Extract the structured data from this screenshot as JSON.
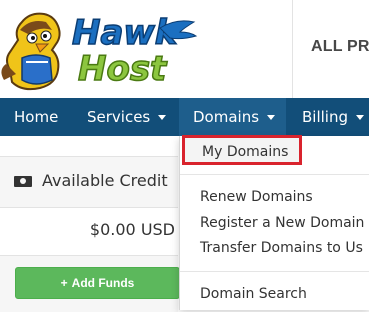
{
  "brand": {
    "logo_text": "HawkHost",
    "logo_alt": "Hawk Host"
  },
  "header": {
    "link_label": "ALL PRO"
  },
  "nav": {
    "items": [
      {
        "label": "Home",
        "has_caret": false
      },
      {
        "label": "Services",
        "has_caret": true
      },
      {
        "label": "Domains",
        "has_caret": true,
        "active": true
      },
      {
        "label": "Billing",
        "has_caret": true
      }
    ]
  },
  "credit": {
    "title": "Available Credit",
    "amount": "$0.00 USD",
    "button_label": "Add Funds",
    "icon": "money-icon"
  },
  "domains_menu": {
    "items": [
      {
        "label": "My Domains",
        "highlighted": true
      },
      {
        "label": "Renew Domains"
      },
      {
        "label": "Register a New Domain"
      },
      {
        "label": "Transfer Domains to Us"
      },
      {
        "label": "Domain Search"
      }
    ]
  },
  "colors": {
    "nav_bg": "#124e79",
    "nav_active": "#1e5e8c",
    "button_green": "#5cb85c",
    "highlight_red": "#d9232d",
    "logo_blue": "#1b6fc0",
    "logo_green": "#8cc63f"
  }
}
